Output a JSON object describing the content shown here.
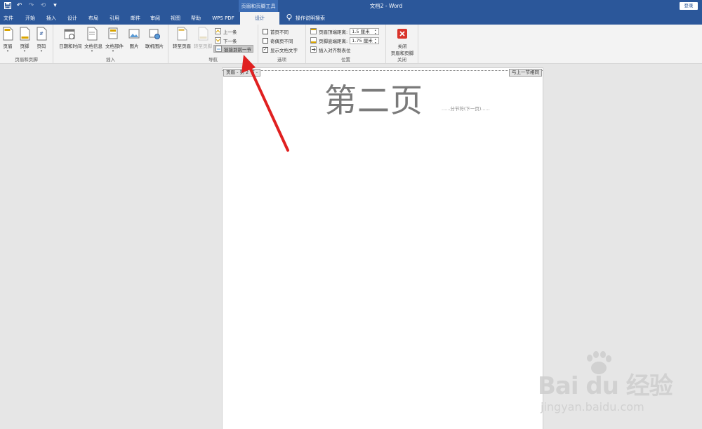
{
  "titlebar": {
    "context_tab_title": "页眉和页脚工具",
    "doc_title": "文档2  -  Word",
    "login": "登录",
    "qat": [
      "save-icon",
      "undo-icon",
      "redo-icon",
      "repeat-icon",
      "customize-icon"
    ]
  },
  "tabs": [
    "文件",
    "开始",
    "插入",
    "设计",
    "布局",
    "引用",
    "邮件",
    "审阅",
    "视图",
    "帮助",
    "WPS PDF",
    "设计"
  ],
  "active_tab_index": 11,
  "tell_me": "操作说明搜索",
  "ribbon": {
    "group_header_footer": {
      "label": "页眉和页脚",
      "buttons": [
        "页眉",
        "页脚",
        "页码"
      ]
    },
    "group_insert": {
      "label": "插入",
      "buttons": [
        "日期和时间",
        "文档信息",
        "文档部件",
        "图片",
        "联机图片"
      ]
    },
    "group_nav": {
      "label": "导航",
      "goto_header": "转至页眉",
      "goto_footer": "转至页脚",
      "prev": "上一条",
      "next": "下一条",
      "link_prev": "链接到前一节"
    },
    "group_options": {
      "label": "选项",
      "diff_first": "首页不同",
      "diff_odd_even": "奇偶页不同",
      "show_doc_text": "显示文档文字",
      "diff_first_checked": false,
      "diff_odd_even_checked": false,
      "show_doc_text_checked": true
    },
    "group_position": {
      "label": "位置",
      "header_top_label": "页眉顶端距离:",
      "header_top_value": "1.5 厘米",
      "footer_bottom_label": "页脚底端距离:",
      "footer_bottom_value": "1.75 厘米",
      "insert_align_tab": "插入对齐制表位"
    },
    "group_close": {
      "label": "关闭",
      "close_line1": "关闭",
      "close_line2": "页眉和页脚"
    }
  },
  "document": {
    "header_tag": "页眉 - 第 2 节 -",
    "same_as_prev_tag": "与上一节相同",
    "header_text": "第二页",
    "section_break": "......分节符(下一页)......"
  },
  "watermark": {
    "main": "Bai  du 经验",
    "sub": "jingyan.baidu.com"
  },
  "colors": {
    "titlebar": "#2b579a",
    "ribbon": "#f3f3f3",
    "arrow": "#e02020",
    "close_button": "#d9342b"
  }
}
